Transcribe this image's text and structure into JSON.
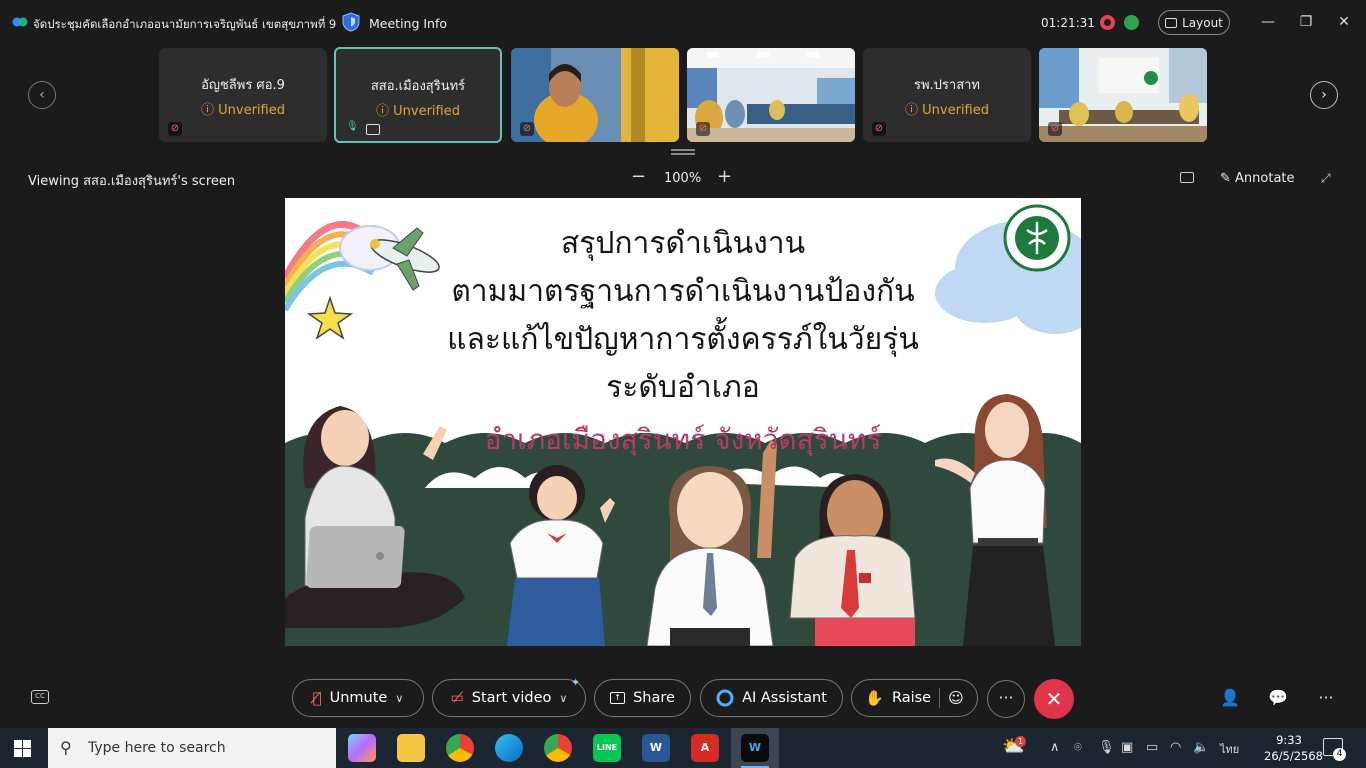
{
  "titlebar": {
    "meeting_name": "จัดประชุมคัดเลือกอำเภออนามัยการเจริญพันธ์ เขตสุขภาพที่ 9",
    "meeting_info": "Meeting Info",
    "timer": "01:21:31",
    "layout_label": "Layout"
  },
  "thumbnails": [
    {
      "name": "อัญชลีพร ศอ.9",
      "status": "Unverified",
      "mic": "muted"
    },
    {
      "name": "สสอ.เมืองสุรินทร์",
      "status": "Unverified",
      "mic": "on",
      "sharing": true,
      "active": true
    },
    {
      "name": "",
      "status": "",
      "mic": "muted",
      "type": "video-person"
    },
    {
      "name": "",
      "status": "",
      "mic": "muted",
      "type": "video-room"
    },
    {
      "name": "รพ.ปราสาท",
      "status": "Unverified",
      "mic": "muted"
    },
    {
      "name": "",
      "status": "",
      "mic": "muted",
      "type": "video-meeting"
    }
  ],
  "share_bar": {
    "viewing_label": "Viewing สสอ.เมืองสุรินทร์'s screen",
    "zoom": "100%",
    "annotate_label": "Annotate"
  },
  "slide": {
    "line1": "สรุปการดำเนินงาน",
    "line2": "ตามมาตรฐานการดำเนินงานป้องกัน",
    "line3": "และแก้ไขปัญหาการตั้งครรภ์ในวัยรุ่น",
    "line4": "ระดับอำเภอ",
    "line5": "อำเภอเมืองสุรินทร์ จังหวัดสุรินทร์",
    "board_color": "#2f4a3c",
    "accent_color": "#b83a6a"
  },
  "toolbar": {
    "unmute_label": "Unmute",
    "start_video_label": "Start video",
    "share_label": "Share",
    "ai_assistant_label": "AI Assistant",
    "raise_label": "Raise",
    "more_label": "···",
    "end_color": "#e0344a"
  },
  "taskbar": {
    "search_placeholder": "Type here to search",
    "language": "ไทย",
    "time": "9:33",
    "date": "26/5/2568",
    "notification_count": "4",
    "weather_badge": "1"
  }
}
